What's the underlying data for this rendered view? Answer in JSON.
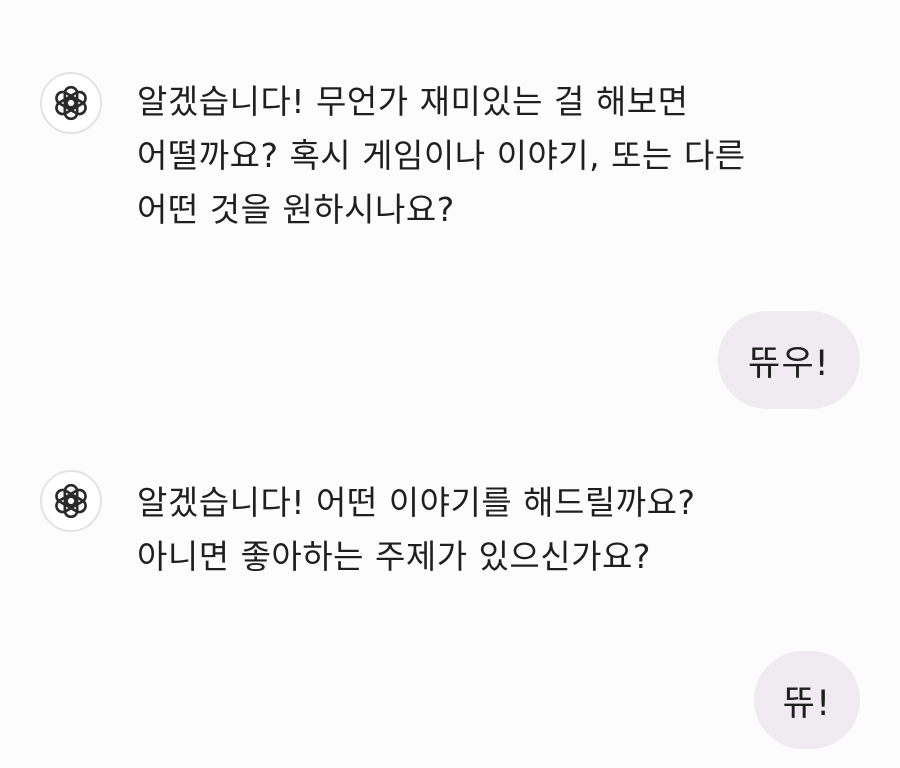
{
  "messages": [
    {
      "role": "assistant",
      "icon": "openai-logo-icon",
      "lines": [
        "알겠습니다! 무언가 재미있는 걸 해보면",
        "어떨까요? 혹시 게임이나 이야기, 또는 다른",
        "어떤 것을 원하시나요?"
      ]
    },
    {
      "role": "user",
      "text": "뜌우!"
    },
    {
      "role": "assistant",
      "icon": "openai-logo-icon",
      "lines": [
        "알겠습니다! 어떤 이야기를 해드릴까요?",
        "아니면 좋아하는 주제가 있으신가요?"
      ]
    },
    {
      "role": "user",
      "text": "뜌!"
    }
  ],
  "colors": {
    "background": "#fdfcfd",
    "user_bubble": "#efebf0",
    "text": "#1f1f1f"
  }
}
